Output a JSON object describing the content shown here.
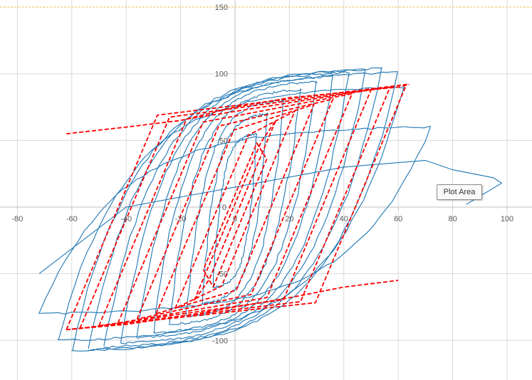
{
  "chart_data": {
    "type": "line",
    "xlim": [
      -84,
      108
    ],
    "ylim": [
      -130,
      150
    ],
    "xticks": [
      -80,
      -60,
      -40,
      -20,
      0,
      20,
      40,
      60,
      80,
      100
    ],
    "yticks": [
      -100,
      -50,
      50,
      100,
      150
    ],
    "grid": true,
    "legend": "none",
    "series": [
      {
        "style": "solid",
        "color": "#1f77b4",
        "loops": [
          {
            "amp_pos": 8,
            "amp_neg": -8,
            "top": 55,
            "bot": -60,
            "offset": 8
          },
          {
            "amp_pos": 12,
            "amp_neg": -12,
            "top": 70,
            "bot": -72,
            "offset": 10
          },
          {
            "amp_pos": 18,
            "amp_neg": -18,
            "top": 80,
            "bot": -82,
            "offset": 12
          },
          {
            "amp_pos": 24,
            "amp_neg": -24,
            "top": 88,
            "bot": -88,
            "offset": 14
          },
          {
            "amp_pos": 30,
            "amp_neg": -30,
            "top": 94,
            "bot": -94,
            "offset": 16
          },
          {
            "amp_pos": 36,
            "amp_neg": -36,
            "top": 98,
            "bot": -98,
            "offset": 18
          },
          {
            "amp_pos": 42,
            "amp_neg": -42,
            "top": 101,
            "bot": -102,
            "offset": 20
          },
          {
            "amp_pos": 48,
            "amp_neg": -48,
            "top": 103,
            "bot": -105,
            "offset": 22
          },
          {
            "amp_pos": 54,
            "amp_neg": -54,
            "top": 104,
            "bot": -107,
            "offset": 24
          },
          {
            "amp_pos": 60,
            "amp_neg": -60,
            "top": 101,
            "bot": -108,
            "offset": 26
          },
          {
            "amp_pos": 62,
            "amp_neg": -65,
            "top": 90,
            "bot": -100,
            "offset": 28
          },
          {
            "amp_pos": 72,
            "amp_neg": -72,
            "top": 60,
            "bot": -80,
            "offset": 30
          }
        ],
        "tail": [
          [
            -72,
            -50
          ],
          [
            -40,
            0
          ],
          [
            0,
            15
          ],
          [
            40,
            30
          ],
          [
            70,
            35
          ],
          [
            80,
            28
          ],
          [
            95,
            22
          ],
          [
            98,
            18
          ],
          [
            85,
            2
          ]
        ]
      },
      {
        "style": "dashed",
        "color": "#ff0000",
        "envelope": [
          [
            -62,
            55
          ],
          [
            -40,
            60
          ],
          [
            -20,
            65
          ],
          [
            0,
            75
          ],
          [
            20,
            82
          ],
          [
            40,
            86
          ],
          [
            60,
            90
          ],
          [
            64,
            92
          ]
        ],
        "envelope_neg": [
          [
            -62,
            -92
          ],
          [
            -40,
            -88
          ],
          [
            -20,
            -82
          ],
          [
            0,
            -75
          ],
          [
            20,
            -68
          ],
          [
            40,
            -60
          ],
          [
            60,
            -55
          ]
        ],
        "loops": [
          {
            "amp_pos": 8,
            "amp_neg": -8,
            "top": 48,
            "bot": -60
          },
          {
            "amp_pos": 15,
            "amp_neg": -15,
            "top": 65,
            "bot": -70
          },
          {
            "amp_pos": 22,
            "amp_neg": -22,
            "top": 72,
            "bot": -76
          },
          {
            "amp_pos": 29,
            "amp_neg": -29,
            "top": 77,
            "bot": -80
          },
          {
            "amp_pos": 36,
            "amp_neg": -36,
            "top": 81,
            "bot": -84
          },
          {
            "amp_pos": 43,
            "amp_neg": -43,
            "top": 85,
            "bot": -87
          },
          {
            "amp_pos": 50,
            "amp_neg": -50,
            "top": 88,
            "bot": -89
          },
          {
            "amp_pos": 57,
            "amp_neg": -57,
            "top": 90,
            "bot": -91
          },
          {
            "amp_pos": 63,
            "amp_neg": -62,
            "top": 92,
            "bot": -92
          }
        ]
      }
    ]
  },
  "tooltip": {
    "label": "Plot Area"
  }
}
